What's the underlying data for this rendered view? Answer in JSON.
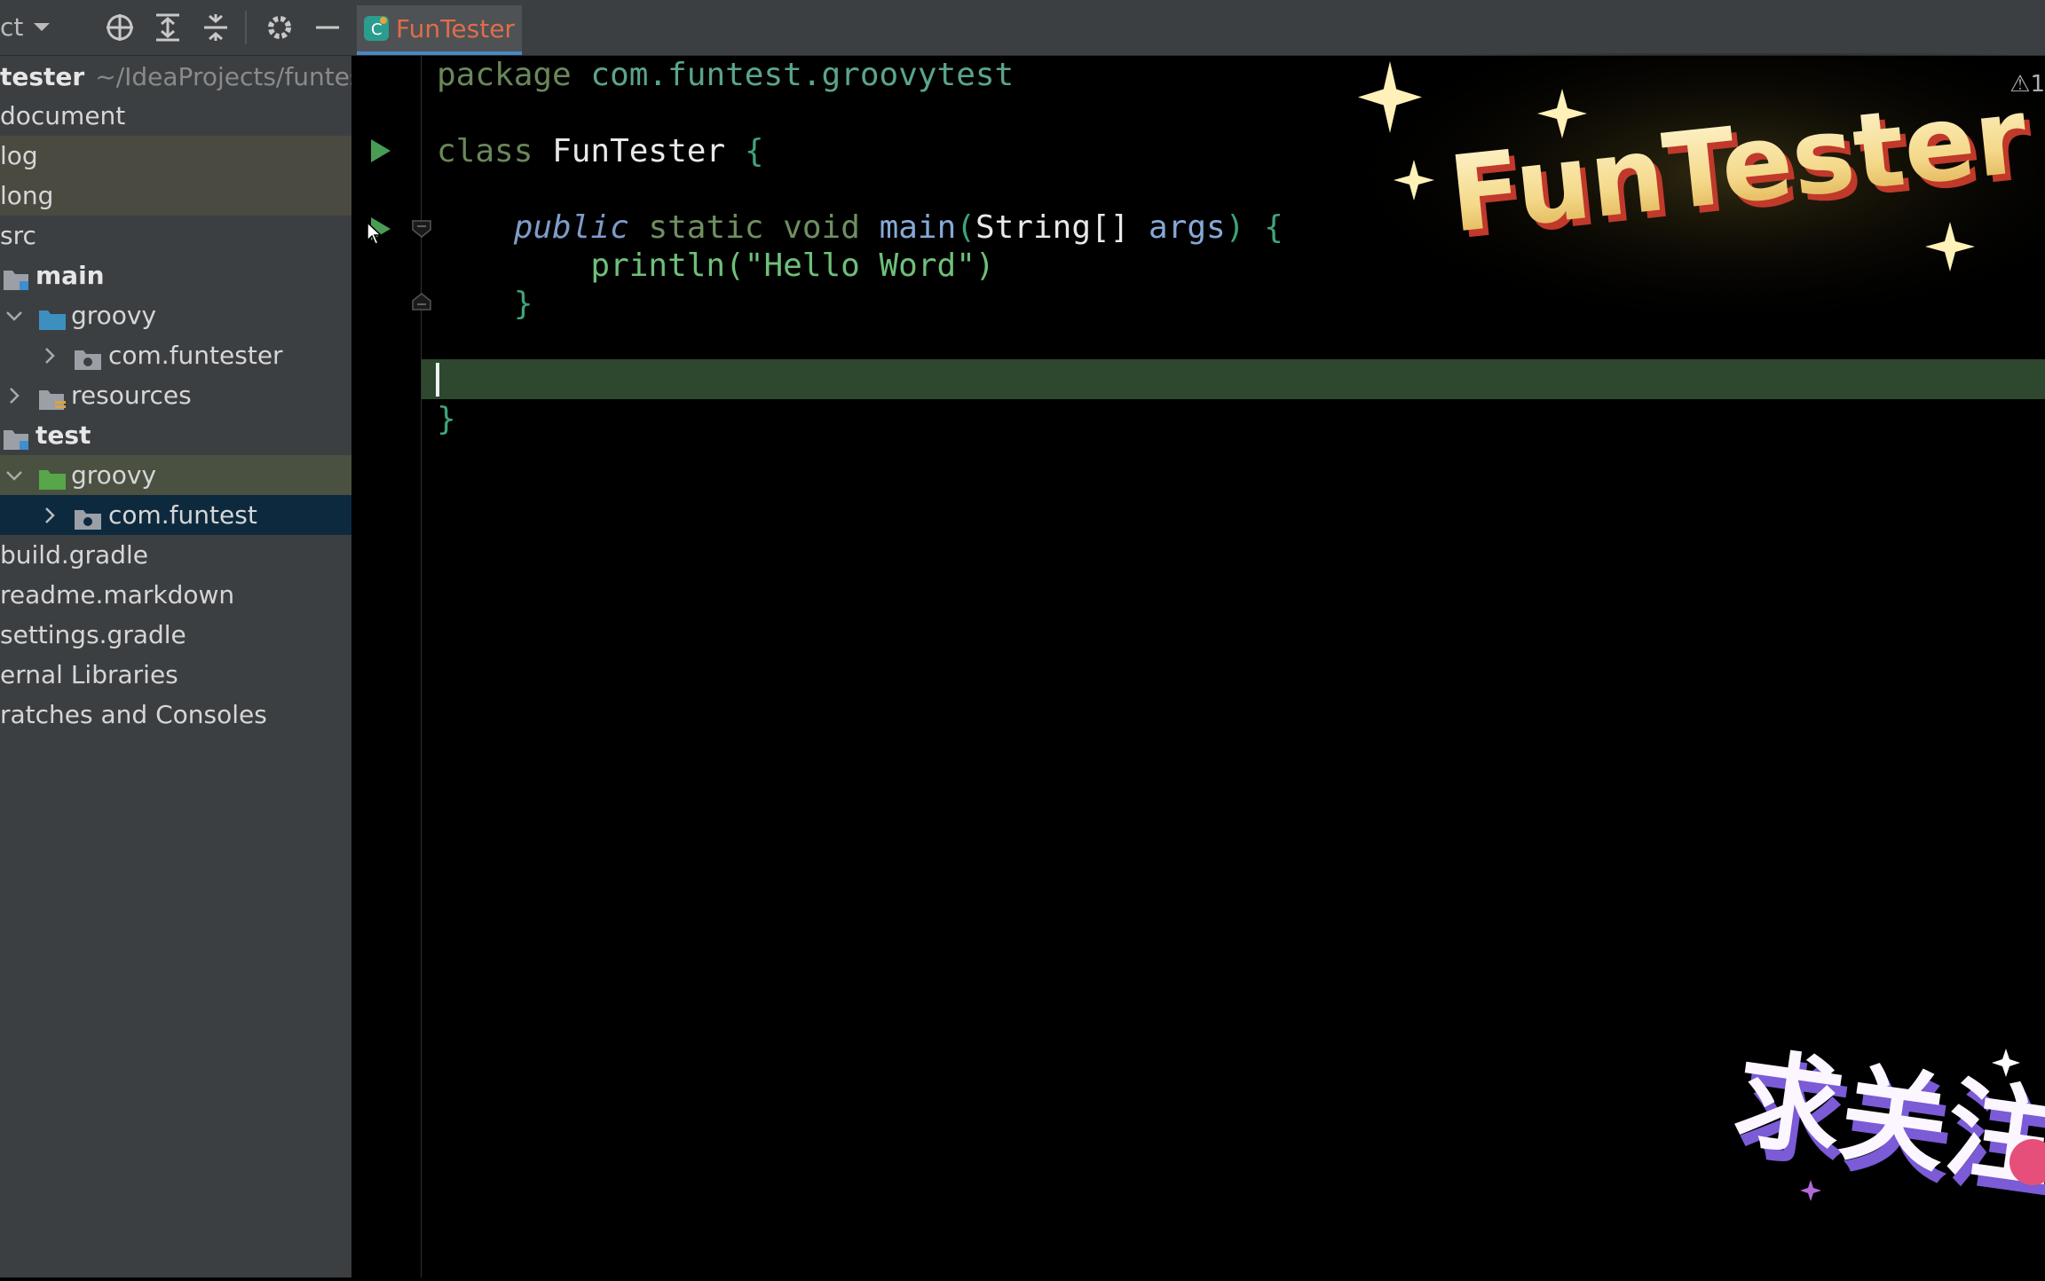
{
  "sidebar": {
    "title": "ct",
    "tree": [
      {
        "label": "tester",
        "hint": "~/IdeaProjects/funtes",
        "bold": true
      },
      {
        "label": "document"
      },
      {
        "label": "log"
      },
      {
        "label": "long"
      },
      {
        "label": "src"
      },
      {
        "label": "main",
        "bold": true
      },
      {
        "label": "groovy"
      },
      {
        "label": "com.funtester"
      },
      {
        "label": "resources"
      },
      {
        "label": "test",
        "bold": true
      },
      {
        "label": "groovy"
      },
      {
        "label": "com.funtest"
      },
      {
        "label": "build.gradle"
      },
      {
        "label": "readme.markdown"
      },
      {
        "label": "settings.gradle"
      },
      {
        "label": "ernal Libraries"
      },
      {
        "label": "ratches and Consoles"
      }
    ]
  },
  "editor": {
    "tab_label": "FunTester",
    "code": {
      "line1_kw": "package",
      "line1_pkg": "com.funtest.groovytest",
      "line2_kw": "class",
      "line2_name": "FunTester",
      "line2_brace": "{",
      "line3_pub": "public",
      "line3_static": "static",
      "line3_void": "void",
      "line3_fn": "main",
      "line3_paren_open": "(",
      "line3_type": "String[]",
      "line3_param": "args",
      "line3_paren_close": ")",
      "line3_brace": "{",
      "line4_fn": "println",
      "line4_str": "(\"Hello Word\")",
      "line5_brace": "}",
      "line7_brace": "}"
    },
    "warning": "⚠1"
  },
  "overlay": {
    "banner_text": "FunTester",
    "bottom_text": "求关注"
  },
  "colors": {
    "sidebar_bg": "#3c3f41",
    "editor_bg": "#000000",
    "current_line": "#2e4830",
    "tab_accent": "#4a88c7",
    "run_green": "#499c54"
  }
}
